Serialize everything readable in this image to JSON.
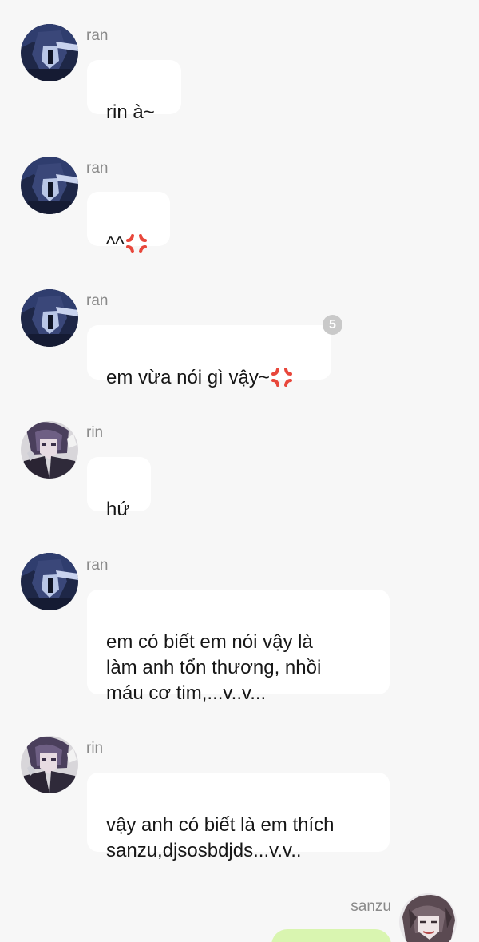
{
  "messages": [
    {
      "sender": "ran",
      "text": "rin à~",
      "avatar": "ran-avatar",
      "emoji": false
    },
    {
      "sender": "ran",
      "text": "^^",
      "avatar": "ran-avatar",
      "emoji": true
    },
    {
      "sender": "ran",
      "text": "em vừa nói gì vậy~",
      "avatar": "ran-avatar",
      "emoji": true,
      "reaction_count": "5"
    },
    {
      "sender": "rin",
      "text": "hứ",
      "avatar": "rin-avatar",
      "emoji": false
    },
    {
      "sender": "ran",
      "text": "em có biết em nói vậy là\nlàm anh tổn thương, nhồi\nmáu cơ tim,...v..v...",
      "avatar": "ran-avatar",
      "emoji": false
    },
    {
      "sender": "rin",
      "text": "vậy anh có biết là em thích\nsanzu,djsosbdjds...v.v..",
      "avatar": "rin-avatar",
      "emoji": false
    }
  ],
  "own_message": {
    "sender": "sanzu",
    "avatar": "sanzu-avatar"
  },
  "colors": {
    "background": "#f7f7f7",
    "bubble": "#ffffff",
    "own_bubble": "#d9f5b0",
    "sender_name": "#8a8a8a",
    "badge": "#c9c9c9",
    "anger_emoji": "#e8473b"
  }
}
